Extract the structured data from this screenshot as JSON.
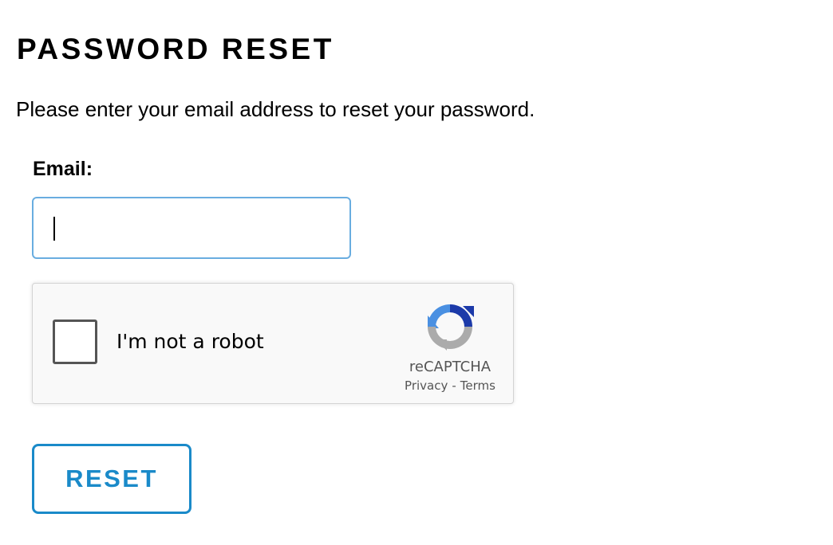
{
  "page": {
    "title": "PASSWORD RESET",
    "instructions": "Please enter your email address to reset your password."
  },
  "form": {
    "email_label": "Email:",
    "email_value": "",
    "reset_label": "RESET"
  },
  "captcha": {
    "checkbox_label": "I'm not a robot",
    "checked": false,
    "brand": "reCAPTCHA",
    "privacy_label": "Privacy",
    "separator": "-",
    "terms_label": "Terms",
    "logo_icon": "recaptcha-logo-icon"
  },
  "colors": {
    "accent": "#1a8ac9",
    "input_focus_border": "#69ade0",
    "captcha_bg": "#f9f9f9",
    "captcha_border": "#d3d3d3",
    "text": "#000000",
    "muted_text": "#555555"
  }
}
